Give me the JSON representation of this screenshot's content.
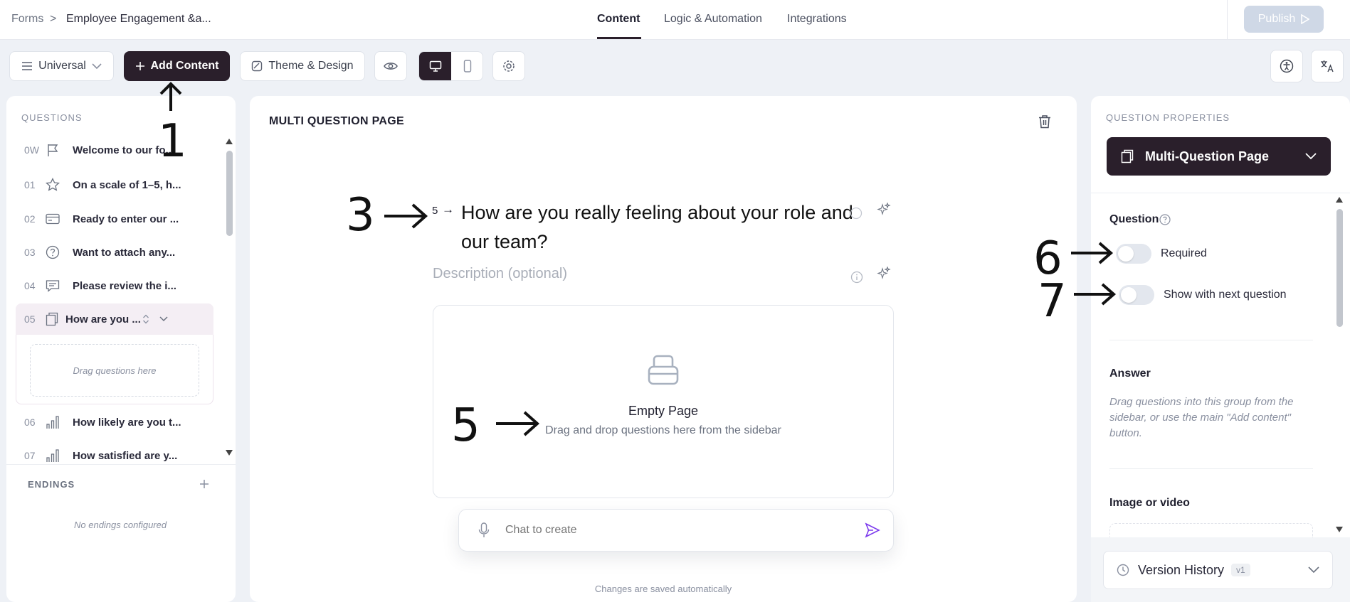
{
  "breadcrumb": {
    "root": "Forms",
    "separator": ">",
    "title": "Employee Engagement &a..."
  },
  "tabs": [
    {
      "label": "Content",
      "active": true
    },
    {
      "label": "Logic & Automation",
      "active": false
    },
    {
      "label": "Integrations",
      "active": false
    }
  ],
  "header": {
    "publish_label": "Publish"
  },
  "toolbar": {
    "view_select": "Universal",
    "add_content": "Add Content",
    "theme_design": "Theme & Design"
  },
  "sidebar": {
    "questions_label": "QUESTIONS",
    "items": [
      {
        "num": "0W",
        "icon": "flag-icon",
        "text": "Welcome to our fo..."
      },
      {
        "num": "01",
        "icon": "star-icon",
        "text": "On a scale of 1–5, h..."
      },
      {
        "num": "02",
        "icon": "card-icon",
        "text": "Ready to enter our ..."
      },
      {
        "num": "03",
        "icon": "help-circle-icon",
        "text": "Want to attach any..."
      },
      {
        "num": "04",
        "icon": "comment-icon",
        "text": "Please review the i..."
      },
      {
        "num": "05",
        "icon": "copy-icon",
        "text": "How are you ..."
      },
      {
        "num": "06",
        "icon": "bar-chart-icon",
        "text": "How likely are you t..."
      },
      {
        "num": "07",
        "icon": "bar-chart-icon",
        "text": "How satisfied are y..."
      }
    ],
    "drag_placeholder": "Drag questions here",
    "endings_label": "ENDINGS",
    "no_endings": "No endings configured"
  },
  "main": {
    "page_label": "MULTI QUESTION PAGE",
    "question_number": "5",
    "question_arrow": "→",
    "question_text": "How are you really feeling about your role and our team?",
    "description_placeholder": "Description (optional)",
    "empty_title": "Empty Page",
    "empty_subtitle": "Drag and drop questions here from the sidebar",
    "chat_placeholder": "Chat to create",
    "autosave": "Changes are saved automatically"
  },
  "properties": {
    "label": "QUESTION PROPERTIES",
    "type_select": "Multi-Question Page",
    "question_heading": "Question",
    "required_label": "Required",
    "required_on": false,
    "show_next_label": "Show with next question",
    "show_next_on": false,
    "answer_heading": "Answer",
    "answer_hint": "Drag questions into this group from the sidebar, or use the main \"Add content\" button.",
    "image_heading": "Image or video",
    "version_history": "Version History",
    "version_badge": "v1"
  },
  "annotations": [
    "1",
    "3",
    "5",
    "6",
    "7"
  ],
  "colors": {
    "accent_dark": "#2a1f2b",
    "purple": "#7c3aed",
    "background": "#eef1f6"
  }
}
